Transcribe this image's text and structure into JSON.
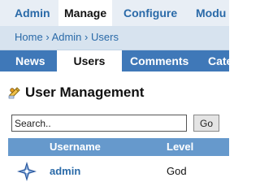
{
  "topnav": {
    "items": [
      {
        "label": "Admin",
        "active": false
      },
      {
        "label": "Manage",
        "active": true
      },
      {
        "label": "Configure",
        "active": false
      },
      {
        "label": "Modu",
        "active": false
      }
    ]
  },
  "breadcrumb": {
    "items": [
      "Home",
      "Admin",
      "Users"
    ],
    "separator": "›"
  },
  "subnav": {
    "tabs": [
      {
        "label": "News",
        "active": false
      },
      {
        "label": "Users",
        "active": true
      },
      {
        "label": "Comments",
        "active": false
      },
      {
        "label": "Cate",
        "active": false
      }
    ]
  },
  "page": {
    "title": "User Management",
    "title_icon": "user-management-icon"
  },
  "search": {
    "value": "Search..",
    "button_label": "Go"
  },
  "table": {
    "headers": [
      "Username",
      "Level"
    ],
    "rows": [
      {
        "username": "admin",
        "level": "God",
        "avatar_icon": "star-avatar-icon"
      }
    ]
  },
  "colors": {
    "link": "#2a6aa8",
    "topnav_bg": "#e8eef5",
    "breadcrumb_bg": "#d7e3ef",
    "subnav_bg": "#3f78b8",
    "table_header_bg": "#6699cc"
  }
}
